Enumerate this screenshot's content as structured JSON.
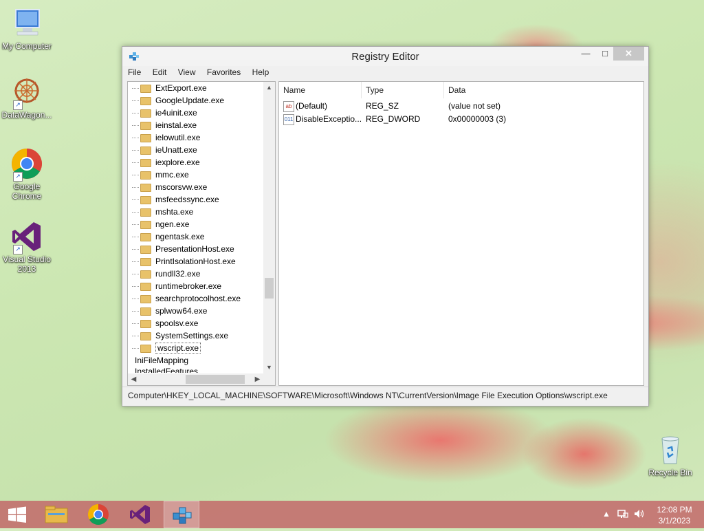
{
  "desktop": {
    "icons": [
      {
        "label": "My Computer"
      },
      {
        "label": "DataWagon..."
      },
      {
        "label": "Google Chrome"
      },
      {
        "label": "Visual Studio 2013"
      },
      {
        "label": "Recycle Bin"
      }
    ]
  },
  "window": {
    "title": "Registry Editor",
    "controls": {
      "minimize": "—",
      "maximize": "□",
      "close": "✕"
    },
    "menu": [
      "File",
      "Edit",
      "View",
      "Favorites",
      "Help"
    ],
    "tree": {
      "items": [
        "ExtExport.exe",
        "GoogleUpdate.exe",
        "ie4uinit.exe",
        "ieinstal.exe",
        "ielowutil.exe",
        "ieUnatt.exe",
        "iexplore.exe",
        "mmc.exe",
        "mscorsvw.exe",
        "msfeedssync.exe",
        "mshta.exe",
        "ngen.exe",
        "ngentask.exe",
        "PresentationHost.exe",
        "PrintIsolationHost.exe",
        "rundll32.exe",
        "runtimebroker.exe",
        "searchprotocolhost.exe",
        "splwow64.exe",
        "spoolsv.exe",
        "SystemSettings.exe",
        "wscript.exe"
      ],
      "selected": "wscript.exe",
      "parent_items": [
        "IniFileMapping",
        "InstalledFeatures"
      ]
    },
    "values": {
      "columns": {
        "name": "Name",
        "type": "Type",
        "data": "Data"
      },
      "rows": [
        {
          "icon": "ab",
          "name": "(Default)",
          "type": "REG_SZ",
          "data": "(value not set)"
        },
        {
          "icon": "011",
          "name": "DisableExceptio...",
          "type": "REG_DWORD",
          "data": "0x00000003 (3)"
        }
      ]
    },
    "status_path": "Computer\\HKEY_LOCAL_MACHINE\\SOFTWARE\\Microsoft\\Windows NT\\CurrentVersion\\Image File Execution Options\\wscript.exe"
  },
  "taskbar": {
    "time": "12:08 PM",
    "date": "3/1/2023"
  }
}
